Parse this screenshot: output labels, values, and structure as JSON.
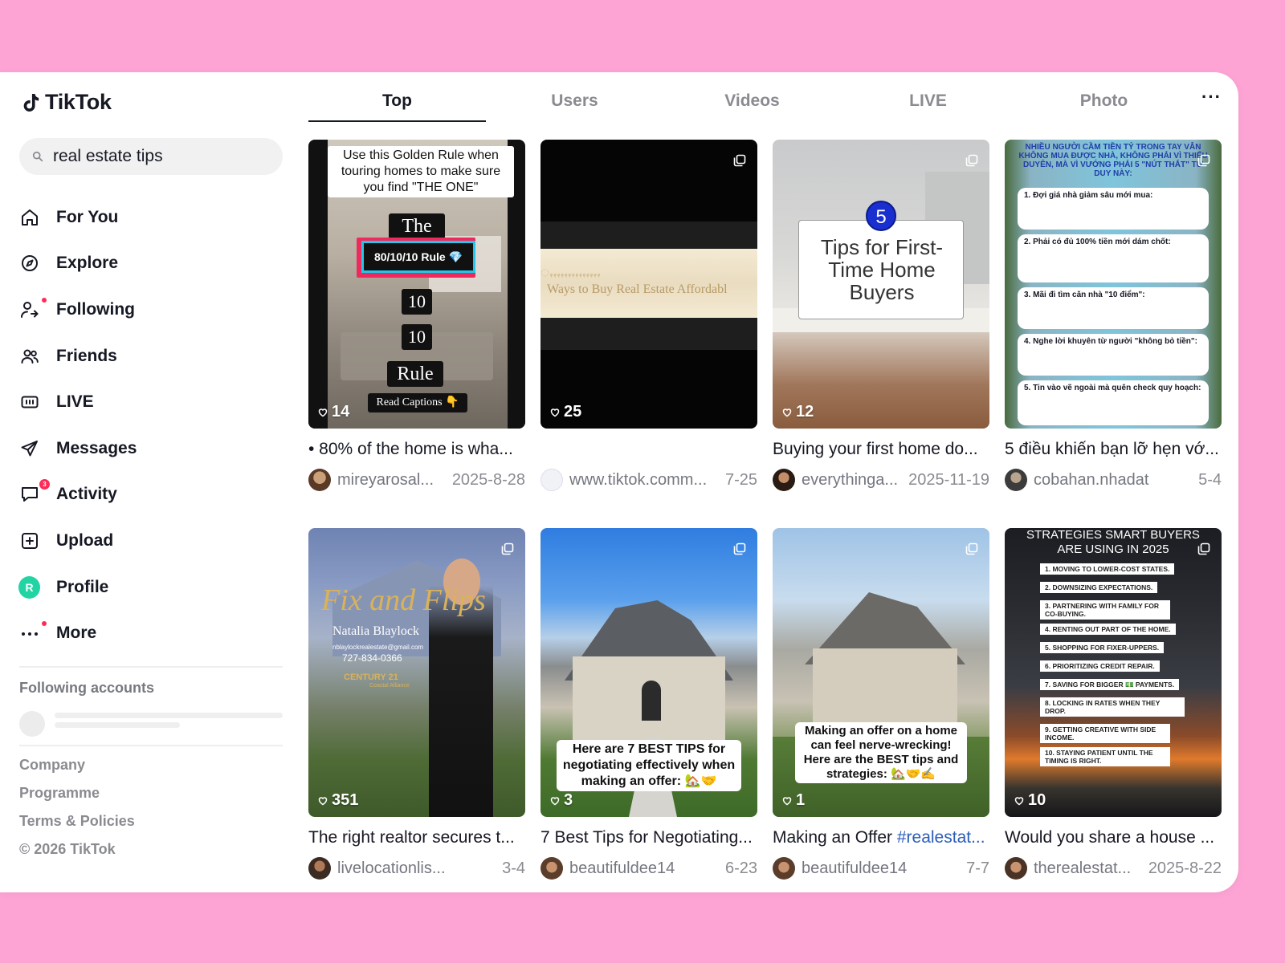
{
  "app": {
    "name": "TikTok"
  },
  "search": {
    "value": "real estate tips"
  },
  "nav": [
    {
      "label": "For You",
      "icon": "home-icon"
    },
    {
      "label": "Explore",
      "icon": "compass-icon"
    },
    {
      "label": "Following",
      "icon": "following-icon"
    },
    {
      "label": "Friends",
      "icon": "friends-icon"
    },
    {
      "label": "LIVE",
      "icon": "live-icon"
    },
    {
      "label": "Messages",
      "icon": "send-icon"
    },
    {
      "label": "Activity",
      "icon": "activity-icon",
      "badge": "3"
    },
    {
      "label": "Upload",
      "icon": "upload-icon"
    },
    {
      "label": "Profile",
      "icon": "profile-avatar",
      "avatar_letter": "R"
    },
    {
      "label": "More",
      "icon": "more-icon"
    }
  ],
  "following_accounts": {
    "title": "Following accounts"
  },
  "footer": {
    "company": "Company",
    "programme": "Programme",
    "terms": "Terms & Policies",
    "copyright": "© 2026 TikTok"
  },
  "tabs": [
    "Top",
    "Users",
    "Videos",
    "LIVE",
    "Photo"
  ],
  "tab_more": "···",
  "colors": {
    "accent": "#fe2c55",
    "background": "#fda4d4",
    "hashtag": "#2b5db9"
  },
  "results": [
    {
      "likes": "14",
      "caption": "• 80% of the home is wha...",
      "user": "mireyarosal...",
      "date": "2025-8-28",
      "overlay": {
        "headline": "Use this Golden Rule when touring homes to make sure you find \"THE ONE\"",
        "the": "The",
        "rule_name": "80/10/10 Rule 💎",
        "ten1": "10",
        "ten2": "10",
        "rule": "Rule",
        "read": "Read Captions 👇"
      }
    },
    {
      "likes": "25",
      "caption": "",
      "user": "www.tiktok.comm...",
      "date": "7-25",
      "overlay": {
        "line2": "Ways to Buy Real Estate Affordabl"
      }
    },
    {
      "likes": "12",
      "caption": "Buying your first home do...",
      "user": "everythinga...",
      "date": "2025-11-19",
      "overlay": {
        "number": "5",
        "text": "Tips for First-Time Home Buyers"
      }
    },
    {
      "likes": "",
      "caption": "5 điều khiến bạn lỡ hẹn vớ...",
      "user": "cobahan.nhadat",
      "date": "5-4",
      "overlay": {
        "title": "NHIỀU NGƯỜI CẦM TIỀN TỶ TRONG TAY VẪN KHÔNG MUA ĐƯỢC NHÀ, KHÔNG PHẢI VÌ THIẾU DUYÊN, MÀ VÌ VƯỚNG PHẢI 5 \"NÚT THẮT\" TƯ DUY NÀY:",
        "items": [
          "1. Đợi giá nhà giảm sâu mới mua:",
          "2. Phải có đủ 100% tiền mới dám chốt:",
          "3. Mãi đi tìm căn nhà \"10 điểm\":",
          "4. Nghe lời khuyên từ người \"không bỏ tiền\":",
          "5. Tin vào vẽ ngoài mà quên check quy hoạch:"
        ]
      }
    },
    {
      "likes": "351",
      "caption": "The right realtor secures t...",
      "user": "livelocationlis...",
      "date": "3-4",
      "overlay": {
        "script": "Fix and Flips",
        "name": "Natalia Blaylock",
        "email": "nblaylockrealestate@gmail.com",
        "phone": "727-834-0366",
        "brand": "CENTURY 21",
        "brand_sub": "Coastal Alliance"
      }
    },
    {
      "likes": "3",
      "caption": "7 Best Tips for Negotiating...",
      "user": "beautifuldee14",
      "date": "6-23",
      "overlay": {
        "text": "Here are 7 BEST TIPS for negotiating effectively when making an offer: 🏡🤝"
      }
    },
    {
      "likes": "1",
      "caption": "Making an Offer ",
      "caption_tag": "#realestat...",
      "user": "beautifuldee14",
      "date": "7-7",
      "overlay": {
        "text": "Making an offer on a home can feel nerve-wrecking! Here are the BEST tips and strategies: 🏡🤝✍️"
      }
    },
    {
      "likes": "10",
      "caption": "Would you share a house ...",
      "user": "therealestat...",
      "date": "2025-8-22",
      "overlay": {
        "title1": "STRATEGIES SMART BUYERS",
        "title2": "ARE USING IN 2025",
        "items": [
          "1. MOVING TO LOWER-COST STATES.",
          "2. DOWNSIZING EXPECTATIONS.",
          "3. PARTNERING WITH FAMILY FOR CO-BUYING.",
          "4. RENTING OUT PART OF THE HOME.",
          "5. SHOPPING FOR FIXER-UPPERS.",
          "6. PRIORITIZING CREDIT REPAIR.",
          "7. SAVING FOR BIGGER 💵 PAYMENTS.",
          "8. LOCKING IN RATES WHEN THEY DROP.",
          "9. GETTING CREATIVE WITH SIDE INCOME.",
          "10. STAYING PATIENT UNTIL THE TIMING IS RIGHT."
        ]
      }
    }
  ]
}
